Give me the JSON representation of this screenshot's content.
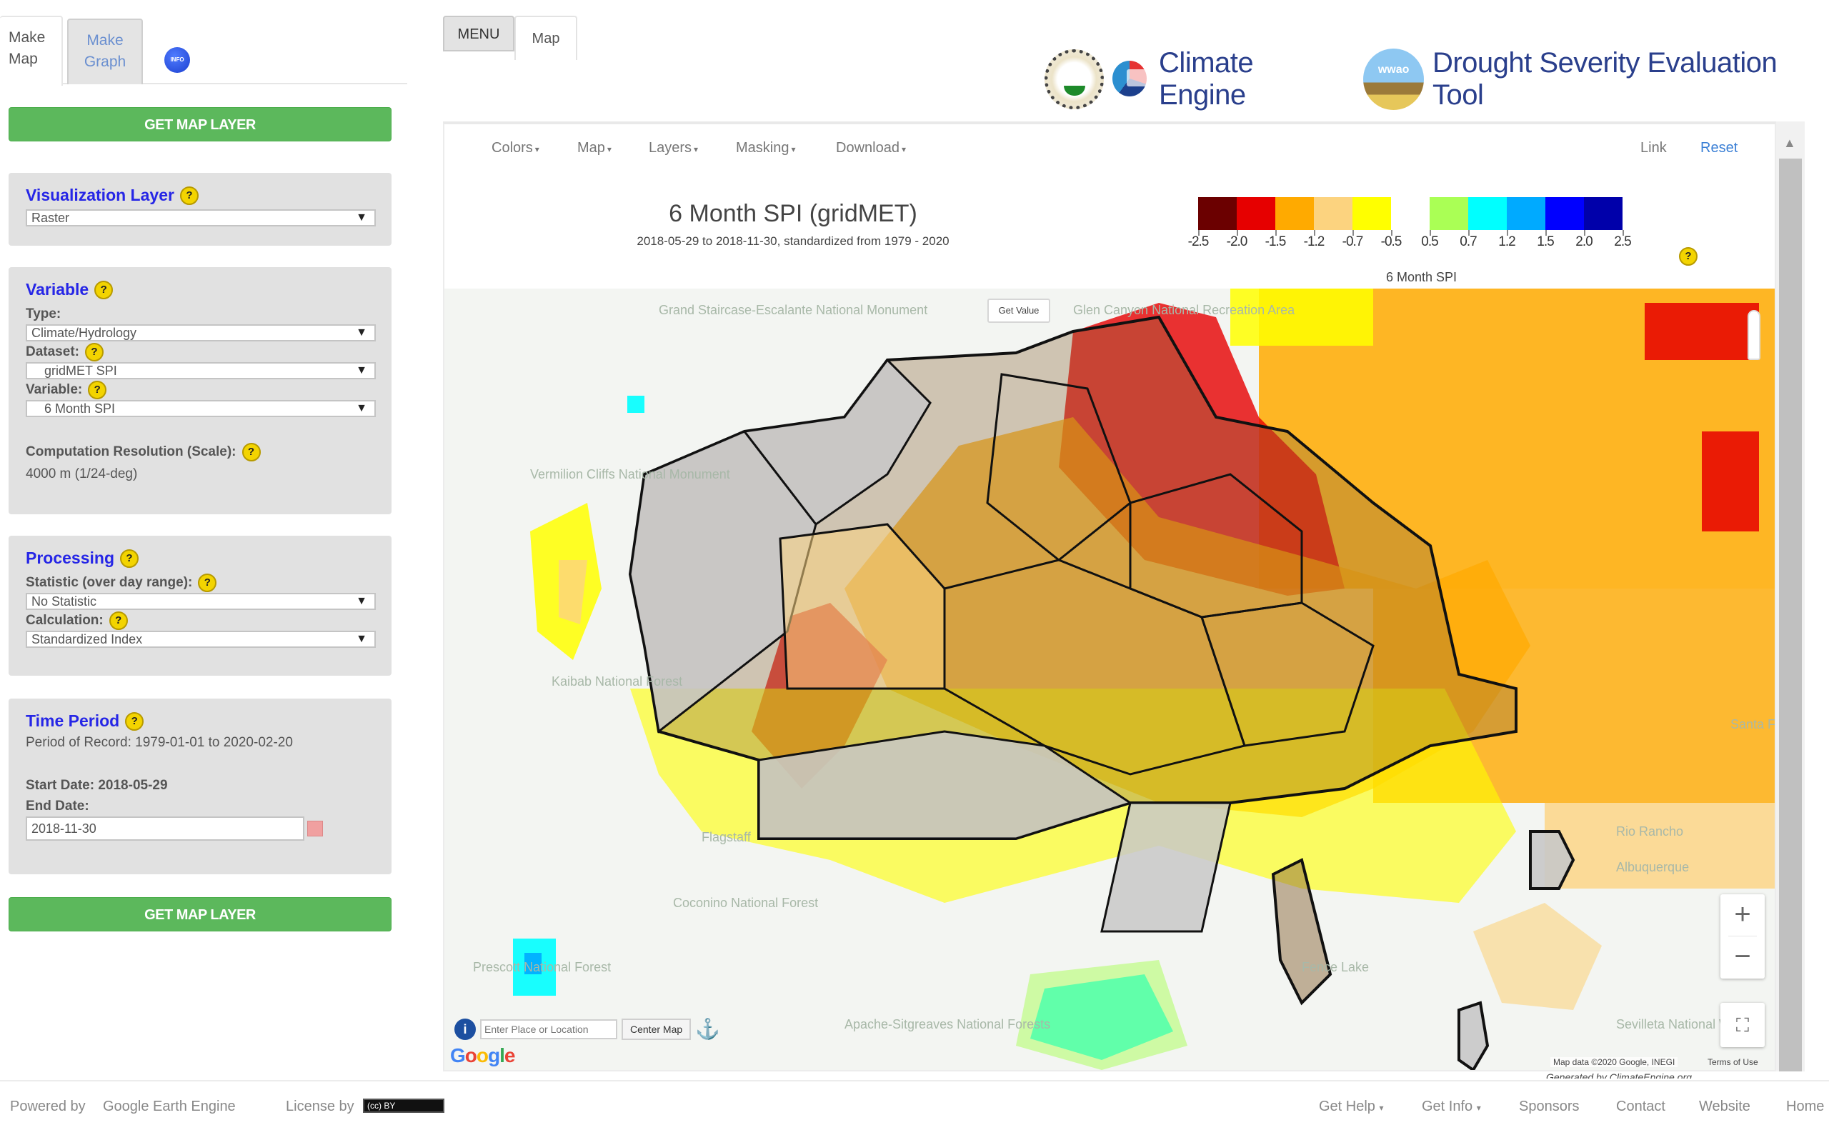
{
  "sidebar": {
    "tabs": [
      {
        "label_line1": "Make",
        "label_line2": "Map",
        "active": true
      },
      {
        "label_line1": "Make",
        "label_line2": "Graph",
        "active": false
      }
    ],
    "info_badge": "INFO",
    "get_map_layer_label": "GET MAP LAYER",
    "visualization": {
      "title": "Visualization Layer",
      "selected": "Raster"
    },
    "variable": {
      "title": "Variable",
      "type_label": "Type:",
      "type_value": "Climate/Hydrology",
      "dataset_label": "Dataset:",
      "dataset_value": "gridMET SPI",
      "variable_label": "Variable:",
      "variable_value": "6 Month SPI",
      "resolution_label": "Computation Resolution (Scale):",
      "resolution_value": "4000 m (1/24-deg)"
    },
    "processing": {
      "title": "Processing",
      "statistic_label": "Statistic (over day range):",
      "statistic_value": "No Statistic",
      "calculation_label": "Calculation:",
      "calculation_value": "Standardized Index"
    },
    "time_period": {
      "title": "Time Period",
      "period_of_record": "Period of Record: 1979-01-01 to 2020-02-20",
      "start_date": "Start Date: 2018-05-29",
      "end_date_label": "End Date:",
      "end_date_value": "2018-11-30"
    },
    "help_glyph": "?"
  },
  "main_tabs": {
    "menu": "MENU",
    "map": "Map"
  },
  "header": {
    "climate_engine": "Climate Engine",
    "wwao_badge": "wwao",
    "tool_title": "Drought Severity Evaluation Tool"
  },
  "toolbar": {
    "menus": [
      "Colors",
      "Map",
      "Layers",
      "Masking",
      "Download"
    ],
    "link": "Link",
    "reset": "Reset",
    "caret": "▾"
  },
  "map_info": {
    "title": "6 Month SPI (gridMET)",
    "subtitle": "2018-05-29 to 2018-11-30, standardized from 1979 - 2020",
    "legend_title": "6 Month SPI",
    "legend": {
      "bins": [
        {
          "from": -2.5,
          "to": -2.0,
          "color": "#6b0000"
        },
        {
          "from": -2.0,
          "to": -1.5,
          "color": "#e60000"
        },
        {
          "from": -1.5,
          "to": -1.2,
          "color": "#ffaa00"
        },
        {
          "from": -1.2,
          "to": -0.7,
          "color": "#fcd37f"
        },
        {
          "from": -0.7,
          "to": -0.5,
          "color": "#ffff00"
        },
        {
          "from": -0.5,
          "to": 0.5,
          "color": "#ffffff"
        },
        {
          "from": 0.5,
          "to": 0.7,
          "color": "#aaff55"
        },
        {
          "from": 0.7,
          "to": 1.2,
          "color": "#00ffff"
        },
        {
          "from": 1.2,
          "to": 1.5,
          "color": "#00aaff"
        },
        {
          "from": 1.5,
          "to": 2.0,
          "color": "#0000ff"
        },
        {
          "from": 2.0,
          "to": 2.5,
          "color": "#0000aa"
        }
      ],
      "tick_labels": [
        "-2.5",
        "-2.0",
        "-1.5",
        "-1.2",
        "-0.7",
        "-0.5",
        "0.5",
        "0.7",
        "1.2",
        "1.5",
        "2.0",
        "2.5"
      ]
    },
    "get_value": "Get Value",
    "place_labels": [
      {
        "text": "Grand Staircase-Escalante National Monument"
      },
      {
        "text": "Vermilion Cliffs National Monument"
      },
      {
        "text": "Kaibab National Forest"
      },
      {
        "text": "Glen Canyon National Recreation Area"
      },
      {
        "text": "Flagstaff"
      },
      {
        "text": "Coconino National Forest"
      },
      {
        "text": "Prescott National Forest"
      },
      {
        "text": "Albuquerque"
      },
      {
        "text": "Rio Rancho"
      },
      {
        "text": "Santa Fe"
      },
      {
        "text": "Apache-Sitgreaves National Forests"
      },
      {
        "text": "Fence Lake"
      },
      {
        "text": "Sevilleta National Wildlife"
      }
    ],
    "search_placeholder": "Enter Place or Location",
    "center_map": "Center Map",
    "google": "Google",
    "attribution": "Map data ©2020 Google, INEGI",
    "terms": "Terms of Use",
    "generated_by": "Generated by ClimateEngine.org",
    "zoom_in": "+",
    "zoom_out": "−",
    "fullscreen": "⛶"
  },
  "footer": {
    "powered_by": "Powered by",
    "gee": "Google Earth Engine",
    "license_by": "License by",
    "cc": "(cc) BY",
    "links": [
      "Get Help",
      "Get Info",
      "Sponsors",
      "Contact",
      "Website",
      "Home"
    ]
  }
}
